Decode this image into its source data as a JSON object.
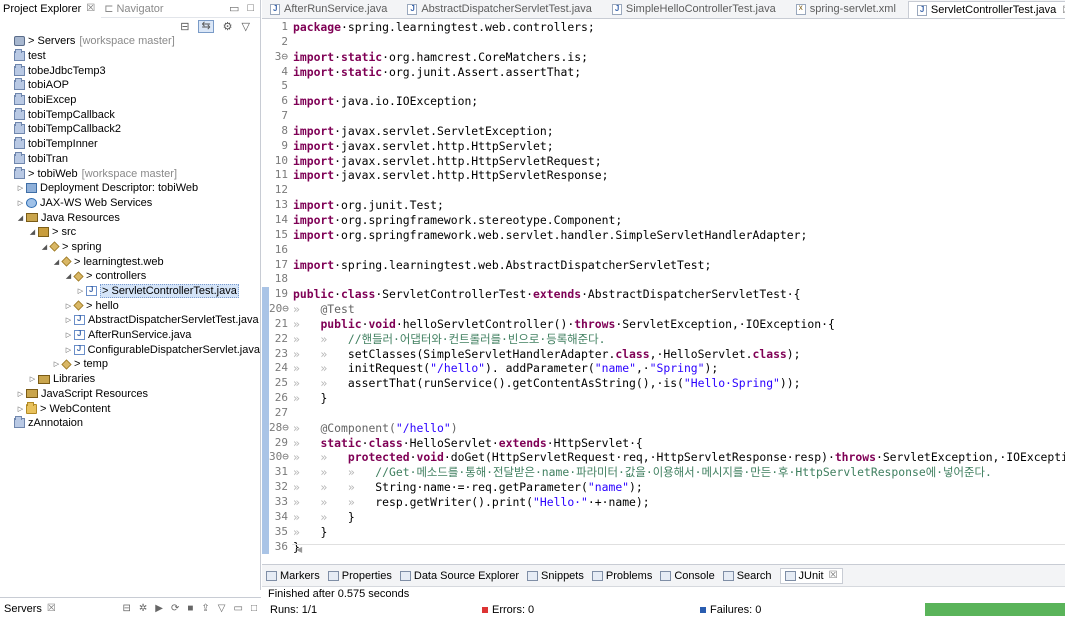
{
  "left_pane": {
    "tabs": [
      {
        "label": "Project Explorer",
        "close": "☒"
      },
      {
        "label": "Navigator"
      }
    ],
    "tree": [
      {
        "label": "> Servers",
        "deco": "[workspace master]",
        "icon": "servers-icon",
        "twisty": ""
      },
      {
        "label": "test",
        "icon": "folder-icon",
        "twisty": ""
      },
      {
        "label": "tobeJdbcTemp3",
        "icon": "folder-icon",
        "twisty": ""
      },
      {
        "label": "tobiAOP",
        "icon": "folder-icon",
        "twisty": ""
      },
      {
        "label": "tobiExcep",
        "icon": "folder-icon",
        "twisty": ""
      },
      {
        "label": "tobiTempCallback",
        "icon": "folder-icon",
        "twisty": ""
      },
      {
        "label": "tobiTempCallback2",
        "icon": "folder-icon",
        "twisty": ""
      },
      {
        "label": "tobiTempInner",
        "icon": "folder-icon",
        "twisty": ""
      },
      {
        "label": "tobiTran",
        "icon": "folder-icon",
        "twisty": ""
      },
      {
        "label": "> tobiWeb",
        "deco": "[workspace master]",
        "icon": "web-project-icon",
        "twisty": ""
      },
      {
        "label": "Deployment Descriptor: tobiWeb",
        "icon": "descriptor-icon",
        "twisty": "▷",
        "indent": 1
      },
      {
        "label": "JAX-WS Web Services",
        "icon": "webservice-icon",
        "twisty": "▷",
        "indent": 1
      },
      {
        "label": "Java Resources",
        "icon": "java-resources-icon",
        "twisty": "◢",
        "indent": 1
      },
      {
        "label": "> src",
        "icon": "source-folder-icon",
        "twisty": "◢",
        "indent": 2
      },
      {
        "label": "> spring",
        "icon": "package-icon",
        "twisty": "◢",
        "indent": 3
      },
      {
        "label": "> learningtest.web",
        "icon": "package-icon",
        "twisty": "◢",
        "indent": 4
      },
      {
        "label": "> controllers",
        "icon": "package-icon",
        "twisty": "◢",
        "indent": 5
      },
      {
        "label": "> ServletControllerTest.java",
        "icon": "java-file-icon",
        "twisty": "▷",
        "indent": 6,
        "selected": true
      },
      {
        "label": "> hello",
        "icon": "package-icon",
        "twisty": "▷",
        "indent": 5
      },
      {
        "label": "AbstractDispatcherServletTest.java",
        "icon": "java-file-icon",
        "twisty": "▷",
        "indent": 5
      },
      {
        "label": "AfterRunService.java",
        "icon": "java-file-icon",
        "twisty": "▷",
        "indent": 5
      },
      {
        "label": "ConfigurableDispatcherServlet.java",
        "icon": "java-file-icon",
        "twisty": "▷",
        "indent": 5
      },
      {
        "label": "> temp",
        "icon": "package-icon",
        "twisty": "▷",
        "indent": 4
      },
      {
        "label": "Libraries",
        "icon": "library-icon",
        "twisty": "▷",
        "indent": 2
      },
      {
        "label": "JavaScript Resources",
        "icon": "library-icon",
        "twisty": "▷",
        "indent": 1
      },
      {
        "label": "> WebContent",
        "icon": "webcontent-folder-icon",
        "twisty": "▷",
        "indent": 1
      },
      {
        "label": "zAnnotaion",
        "icon": "folder-icon",
        "twisty": ""
      }
    ],
    "servers_view": {
      "label": "Servers",
      "close": "☒"
    }
  },
  "editor": {
    "tabs": [
      {
        "label": "AfterRunService.java",
        "icon": "j"
      },
      {
        "label": "AbstractDispatcherServletTest.java",
        "icon": "j"
      },
      {
        "label": "SimpleHelloControllerTest.java",
        "icon": "j"
      },
      {
        "label": "spring-servlet.xml",
        "icon": "x"
      },
      {
        "label": "ServletControllerTest.java",
        "icon": "j",
        "active": true,
        "close": "☒"
      }
    ],
    "lines": [
      {
        "n": "1",
        "t": [
          [
            "kw",
            "package"
          ],
          [
            "",
            "·spring.learningtest.web.controllers;"
          ]
        ]
      },
      {
        "n": "2",
        "t": []
      },
      {
        "n": "3⊖",
        "t": [
          [
            "kw",
            "import"
          ],
          [
            "",
            "·"
          ],
          [
            "kw",
            "static"
          ],
          [
            "",
            "·org.hamcrest.CoreMatchers."
          ],
          [
            "",
            "is"
          ],
          [
            "",
            ";"
          ]
        ]
      },
      {
        "n": "4",
        "t": [
          [
            "kw",
            "import"
          ],
          [
            "",
            "·"
          ],
          [
            "kw",
            "static"
          ],
          [
            "",
            "·org.junit.Assert.assertThat;"
          ]
        ]
      },
      {
        "n": "5",
        "t": []
      },
      {
        "n": "6",
        "t": [
          [
            "kw",
            "import"
          ],
          [
            "",
            "·java.io.IOException;"
          ]
        ]
      },
      {
        "n": "7",
        "t": []
      },
      {
        "n": "8",
        "t": [
          [
            "kw",
            "import"
          ],
          [
            "",
            "·javax.servlet.ServletException;"
          ]
        ]
      },
      {
        "n": "9",
        "t": [
          [
            "kw",
            "import"
          ],
          [
            "",
            "·javax.servlet.http.HttpServlet;"
          ]
        ]
      },
      {
        "n": "10",
        "t": [
          [
            "kw",
            "import"
          ],
          [
            "",
            "·javax.servlet.http.HttpServletRequest;"
          ]
        ]
      },
      {
        "n": "11",
        "t": [
          [
            "kw",
            "import"
          ],
          [
            "",
            "·javax.servlet.http.HttpServletResponse;"
          ]
        ]
      },
      {
        "n": "12",
        "t": []
      },
      {
        "n": "13",
        "t": [
          [
            "kw",
            "import"
          ],
          [
            "",
            "·org.junit.Test;"
          ]
        ]
      },
      {
        "n": "14",
        "t": [
          [
            "kw",
            "import"
          ],
          [
            "",
            "·org.springframework.stereotype.Component;"
          ]
        ]
      },
      {
        "n": "15",
        "t": [
          [
            "kw",
            "import"
          ],
          [
            "",
            "·org.springframework.web.servlet.handler.SimpleServletHandlerAdapter;"
          ]
        ]
      },
      {
        "n": "16",
        "t": []
      },
      {
        "n": "17",
        "t": [
          [
            "kw",
            "import"
          ],
          [
            "",
            "·spring.learningtest.web.AbstractDispatcherServletTest;"
          ]
        ]
      },
      {
        "n": "18",
        "t": []
      },
      {
        "n": "19",
        "t": [
          [
            "kw",
            "public"
          ],
          [
            "",
            "·"
          ],
          [
            "kw",
            "class"
          ],
          [
            "",
            "·ServletControllerTest·"
          ],
          [
            "kw",
            "extends"
          ],
          [
            "",
            "·AbstractDispatcherServletTest·{"
          ]
        ]
      },
      {
        "n": "20⊖",
        "t": [
          [
            "ws",
            "»   "
          ],
          [
            "ann",
            "@Test"
          ]
        ]
      },
      {
        "n": "21",
        "t": [
          [
            "ws",
            "»   "
          ],
          [
            "kw",
            "public"
          ],
          [
            "",
            "·"
          ],
          [
            "kw",
            "void"
          ],
          [
            "",
            "·helloServletController()·"
          ],
          [
            "kw",
            "throws"
          ],
          [
            "",
            "·ServletException,·IOException·{"
          ]
        ]
      },
      {
        "n": "22",
        "t": [
          [
            "ws",
            "»   »   "
          ],
          [
            "com",
            "//핸들러·어댑터와·컨트롤러를·빈으로·등록해준다."
          ]
        ]
      },
      {
        "n": "23",
        "t": [
          [
            "ws",
            "»   »   "
          ],
          [
            "",
            "setClasses(SimpleServletHandlerAdapter."
          ],
          [
            "kw",
            "class"
          ],
          [
            "",
            ",·HelloServlet."
          ],
          [
            "kw",
            "class"
          ],
          [
            "",
            ");"
          ]
        ]
      },
      {
        "n": "24",
        "t": [
          [
            "ws",
            "»   »   "
          ],
          [
            "",
            "initRequest("
          ],
          [
            "str",
            "\"/hello\""
          ],
          [
            "",
            "). addParameter("
          ],
          [
            "str",
            "\"name\""
          ],
          [
            "",
            ",·"
          ],
          [
            "str",
            "\"Spring\""
          ],
          [
            "",
            ");"
          ]
        ]
      },
      {
        "n": "25",
        "t": [
          [
            "ws",
            "»   »   "
          ],
          [
            "",
            "assertThat(runService().getContentAsString(),·is("
          ],
          [
            "str",
            "\"Hello·Spring\""
          ],
          [
            "",
            "));"
          ]
        ]
      },
      {
        "n": "26",
        "t": [
          [
            "ws",
            "»   "
          ],
          [
            "",
            "}"
          ]
        ]
      },
      {
        "n": "27",
        "t": []
      },
      {
        "n": "28⊖",
        "t": [
          [
            "ws",
            "»   "
          ],
          [
            "ann",
            "@Component("
          ],
          [
            "str",
            "\"/hello\""
          ],
          [
            "ann",
            ")"
          ]
        ]
      },
      {
        "n": "29",
        "t": [
          [
            "ws",
            "»   "
          ],
          [
            "kw",
            "static"
          ],
          [
            "",
            "·"
          ],
          [
            "kw",
            "class"
          ],
          [
            "",
            "·HelloServlet·"
          ],
          [
            "kw",
            "extends"
          ],
          [
            "",
            "·HttpServlet·{"
          ]
        ]
      },
      {
        "n": "30⊖",
        "t": [
          [
            "ws",
            "»   »   "
          ],
          [
            "kw",
            "protected"
          ],
          [
            "",
            "·"
          ],
          [
            "kw",
            "void"
          ],
          [
            "",
            "·doGet(HttpServletRequest·req,·HttpServletResponse·resp)·"
          ],
          [
            "kw",
            "throws"
          ],
          [
            "",
            "·ServletException,·IOException·{"
          ]
        ]
      },
      {
        "n": "31",
        "t": [
          [
            "ws",
            "»   »   »   "
          ],
          [
            "com",
            "//Get·메소드를·통해·전달받은·name·파라미터·값을·이용해서·메시지를·만든·후·HttpServletResponse에·넣어준다."
          ]
        ]
      },
      {
        "n": "32",
        "t": [
          [
            "ws",
            "»   »   »   "
          ],
          [
            "",
            "String·name·=·req.getParameter("
          ],
          [
            "str",
            "\"name\""
          ],
          [
            "",
            ");"
          ]
        ]
      },
      {
        "n": "33",
        "t": [
          [
            "ws",
            "»   »   »   "
          ],
          [
            "",
            "resp.getWriter().print("
          ],
          [
            "str",
            "\"Hello·\""
          ],
          [
            "",
            "·+·name);"
          ]
        ]
      },
      {
        "n": "34",
        "t": [
          [
            "ws",
            "»   »   "
          ],
          [
            "",
            "}"
          ]
        ]
      },
      {
        "n": "35",
        "t": [
          [
            "ws",
            "»   "
          ],
          [
            "",
            "}"
          ]
        ]
      },
      {
        "n": "36",
        "t": [
          [
            "",
            "}"
          ]
        ]
      }
    ]
  },
  "bottom_panel": {
    "tabs": [
      {
        "label": "Markers",
        "icon": "markers-icon"
      },
      {
        "label": "Properties",
        "icon": "properties-icon"
      },
      {
        "label": "Data Source Explorer",
        "icon": "datasource-icon"
      },
      {
        "label": "Snippets",
        "icon": "snippets-icon"
      },
      {
        "label": "Problems",
        "icon": "problems-icon"
      },
      {
        "label": "Console",
        "icon": "console-icon"
      },
      {
        "label": "Search",
        "icon": "search-icon"
      },
      {
        "label": "JUnit",
        "icon": "junit-icon",
        "active": true,
        "close": "☒"
      }
    ],
    "status": "Finished after 0.575 seconds",
    "runs": "Runs:  1/1",
    "errors": "Errors:  0",
    "failures": "Failures:  0",
    "progress_fraction": 1.0,
    "progress_color": "#5ab45a"
  }
}
